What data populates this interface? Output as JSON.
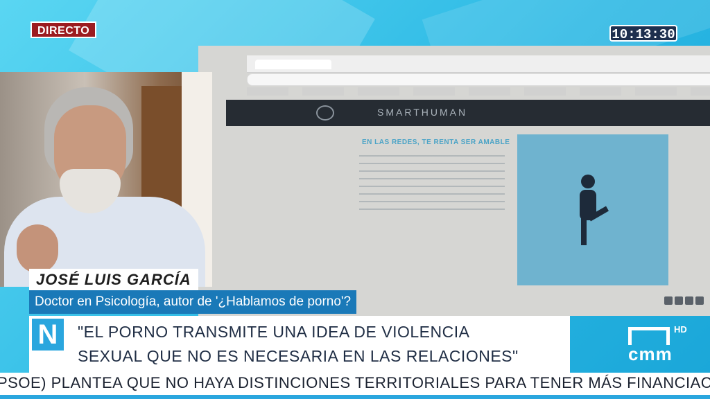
{
  "live_badge": "DIRECTO",
  "clock": "10:13:30",
  "screen": {
    "site_name": "SMARTHUMAN",
    "article_title": "EN LAS REDES, TE RENTA SER AMABLE"
  },
  "lower_third": {
    "name": "JOSÉ LUIS GARCÍA",
    "role": "Doctor en Psicología, autor de '¿Hablamos de porno'?"
  },
  "quote": {
    "logo_letter": "N",
    "text": "\"EL PORNO TRANSMITE UNA IDEA DE VIOLENCIA\nSEXUAL QUE NO ES NECESARIA EN LAS RELACIONES\""
  },
  "channel": {
    "name": "cmm",
    "hd": "HD"
  },
  "ticker": "PSOE) PLANTEA QUE NO HAYA DISTINCIONES TERRITORIALES PARA TENER MÁS FINANCIACI",
  "colors": {
    "background": "#3fc8ea",
    "live_badge": "#9c1c20",
    "role_bar": "#1a79b8",
    "accent": "#2aa6de"
  }
}
